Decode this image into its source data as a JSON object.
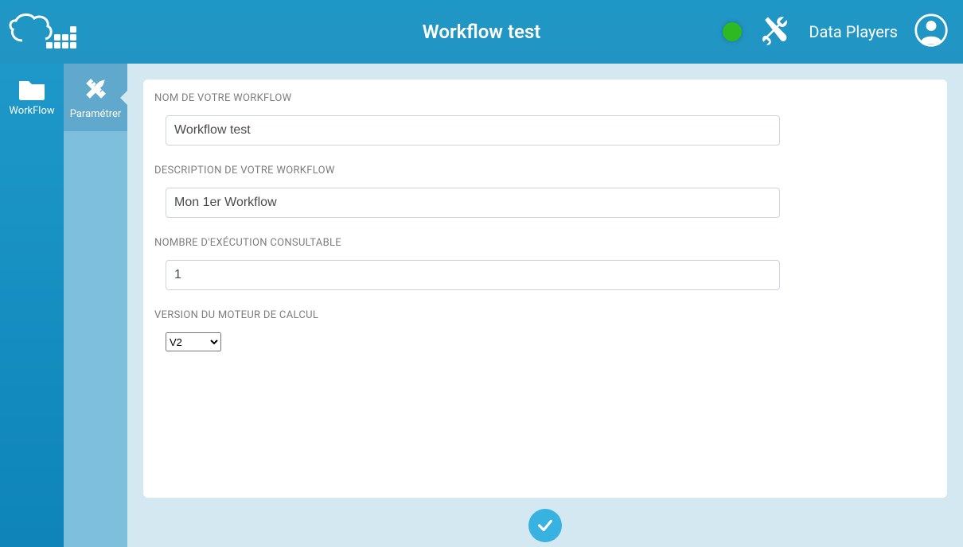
{
  "header": {
    "title": "Workflow test",
    "brand": "Data Players"
  },
  "sidebar": {
    "workflow_label": "WorkFlow"
  },
  "subsidebar": {
    "params_label": "Paramétrer"
  },
  "form": {
    "name_label": "NOM DE VOTRE WORKFLOW",
    "name_value": "Workflow test",
    "description_label": "DESCRIPTION DE VOTRE WORKFLOW",
    "description_value": "Mon 1er Workflow",
    "exec_count_label": "NOMBRE D'EXÉCUTION CONSULTABLE",
    "exec_count_value": "1",
    "engine_label": "VERSION DU MOTEUR DE CALCUL",
    "engine_value": "V2"
  }
}
